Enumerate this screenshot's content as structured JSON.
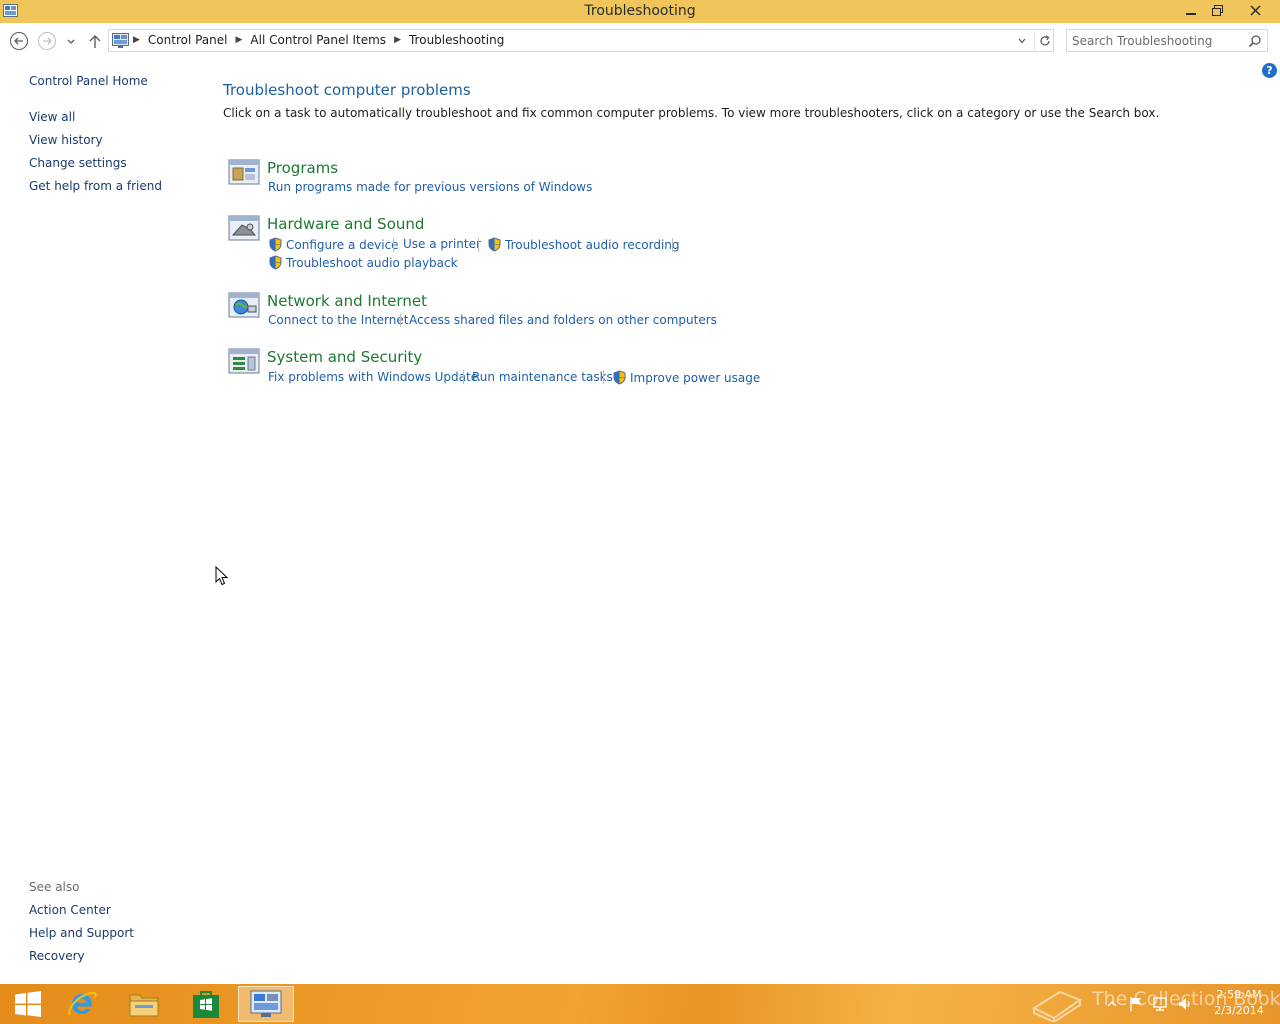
{
  "window": {
    "title": "Troubleshooting",
    "minimize_glyph": "—",
    "restore_glyph": "❐",
    "close_glyph": "✕"
  },
  "address_bar": {
    "crumbs": [
      "Control Panel",
      "All Control Panel Items",
      "Troubleshooting"
    ],
    "crumb_separator": "▶"
  },
  "search": {
    "placeholder": "Search Troubleshooting"
  },
  "left_pane": {
    "home": "Control Panel Home",
    "links": [
      "View all",
      "View history",
      "Change settings",
      "Get help from a friend"
    ],
    "see_also_label": "See also",
    "see_also": [
      "Action Center",
      "Help and Support",
      "Recovery"
    ]
  },
  "help_glyph": "?",
  "main": {
    "heading": "Troubleshoot computer problems",
    "description": "Click on a task to automatically troubleshoot and fix common computer problems. To view more troubleshooters, click on a category or use the Search box.",
    "categories": [
      {
        "title": "Programs",
        "icon": "programs-icon",
        "tasks": [
          "Run programs made for previous versions of Windows"
        ]
      },
      {
        "title": "Hardware and Sound",
        "icon": "hardware-sound-icon",
        "tasks": [
          "Configure a device",
          "Use a printer",
          "Troubleshoot audio recording",
          "Troubleshoot audio playback"
        ]
      },
      {
        "title": "Network and Internet",
        "icon": "network-internet-icon",
        "tasks": [
          "Connect to the Internet",
          "Access shared files and folders on other computers"
        ]
      },
      {
        "title": "System and Security",
        "icon": "system-security-icon",
        "tasks": [
          "Fix problems with Windows Update",
          "Run maintenance tasks",
          "Improve power usage"
        ]
      }
    ]
  },
  "taskbar": {
    "items": [
      "start-button",
      "internet-explorer",
      "file-explorer",
      "windows-store",
      "control-panel"
    ],
    "clock_time": "2:59 AM",
    "clock_date": "2/3/2014",
    "watermark": "The Collection Book",
    "colors": {
      "taskbar": "#eb9a28",
      "titlebar": "#f0c65b"
    }
  }
}
